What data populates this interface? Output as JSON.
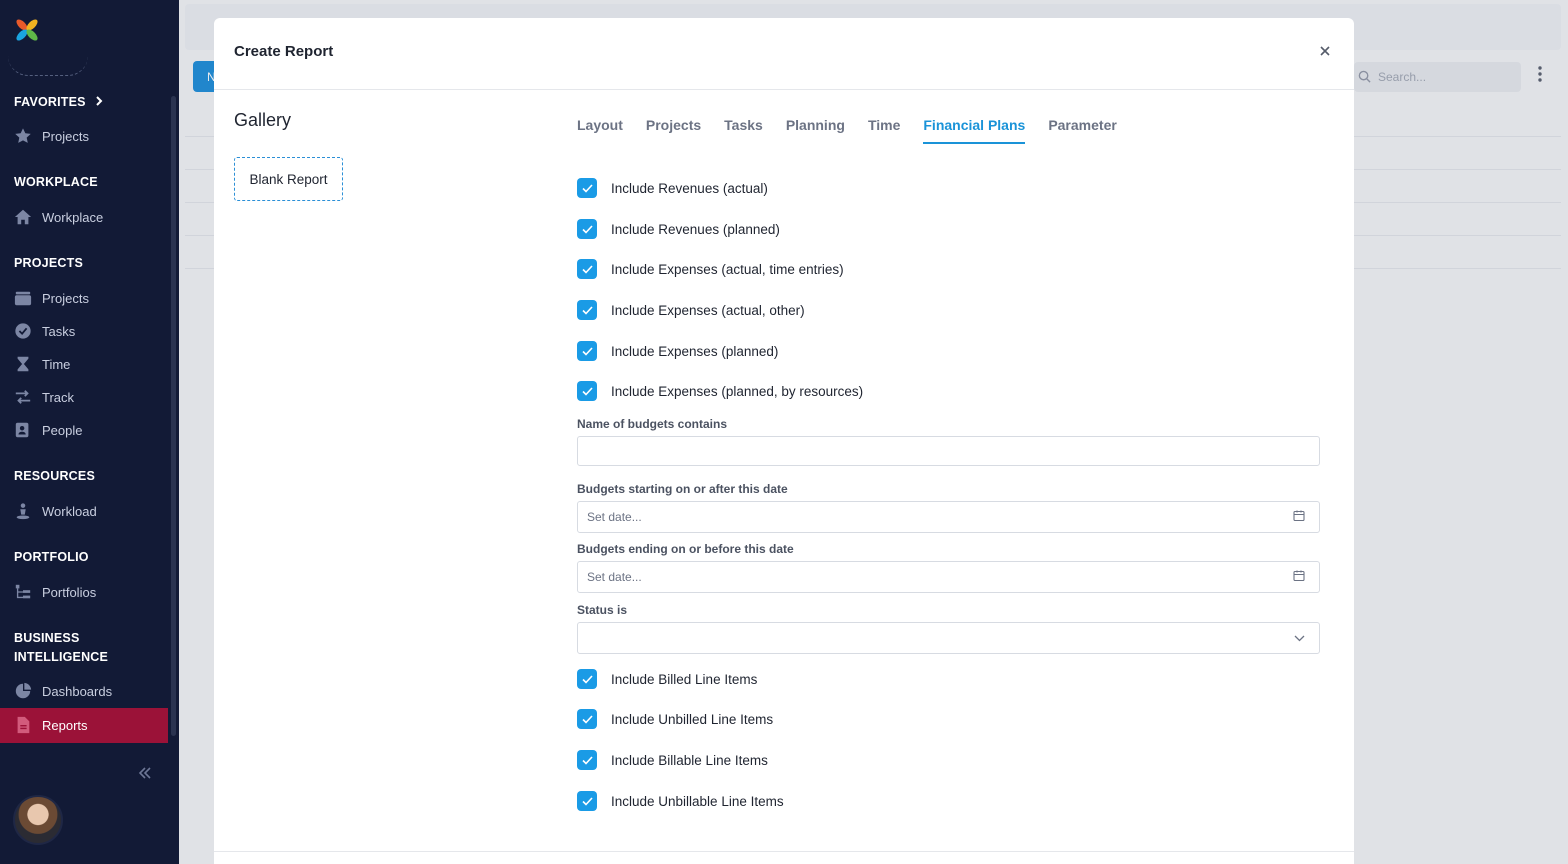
{
  "sidebar": {
    "sections": [
      {
        "title": "FAVORITES",
        "chevron": "chevron-right-icon",
        "items": [
          {
            "label": "Projects",
            "icon": "star-icon"
          }
        ]
      },
      {
        "title": "WORKPLACE",
        "items": [
          {
            "label": "Workplace",
            "icon": "home-icon"
          }
        ]
      },
      {
        "title": "PROJECTS",
        "items": [
          {
            "label": "Projects",
            "icon": "folder-icon"
          },
          {
            "label": "Tasks",
            "icon": "check-circle-icon"
          },
          {
            "label": "Time",
            "icon": "hourglass-icon"
          },
          {
            "label": "Track",
            "icon": "arrows-icon"
          },
          {
            "label": "People",
            "icon": "contact-icon"
          }
        ]
      },
      {
        "title": "RESOURCES",
        "items": [
          {
            "label": "Workload",
            "icon": "person-pin-icon"
          }
        ]
      },
      {
        "title": "PORTFOLIO",
        "items": [
          {
            "label": "Portfolios",
            "icon": "hierarchy-icon"
          }
        ]
      },
      {
        "title_line1": "BUSINESS",
        "title_line2": "INTELLIGENCE",
        "items": [
          {
            "label": "Dashboards",
            "icon": "pie-icon"
          },
          {
            "label": "Reports",
            "icon": "report-icon",
            "active": true
          }
        ]
      }
    ],
    "active_color": "#9b1238",
    "collapse_icon": "double-chevron-left-icon"
  },
  "background": {
    "button_label": "N",
    "search_placeholder": "Search..."
  },
  "modal": {
    "title": "Create Report",
    "gallery_title": "Gallery",
    "gallery_item": "Blank Report",
    "tabs": [
      "Layout",
      "Projects",
      "Tasks",
      "Planning",
      "Time",
      "Financial Plans",
      "Parameter"
    ],
    "active_tab": "Financial Plans",
    "checks_top": [
      {
        "label": "Include Revenues (actual)",
        "checked": true
      },
      {
        "label": "Include Revenues (planned)",
        "checked": true
      },
      {
        "label": "Include Expenses (actual, time entries)",
        "checked": true
      },
      {
        "label": "Include Expenses (actual, other)",
        "checked": true
      },
      {
        "label": "Include Expenses (planned)",
        "checked": true
      },
      {
        "label": "Include Expenses (planned, by resources)",
        "checked": true
      }
    ],
    "fields": {
      "budget_name_label": "Name of budgets contains",
      "budget_name_value": "",
      "start_label": "Budgets starting on or after this date",
      "start_placeholder": "Set date...",
      "end_label": "Budgets ending on or before this date",
      "end_placeholder": "Set date...",
      "status_label": "Status is",
      "status_value": ""
    },
    "checks_bottom": [
      {
        "label": "Include Billed Line Items",
        "checked": true
      },
      {
        "label": "Include Unbilled Line Items",
        "checked": true
      },
      {
        "label": "Include Billable Line Items",
        "checked": true
      },
      {
        "label": "Include Unbillable Line Items",
        "checked": true
      }
    ],
    "accent_color": "#1a93d8"
  }
}
